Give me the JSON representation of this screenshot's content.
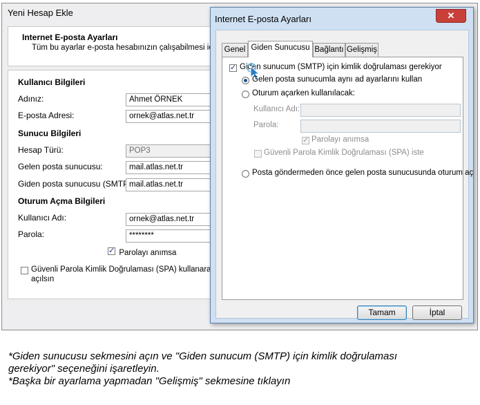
{
  "background_window": {
    "title": "Yeni Hesap Ekle",
    "header_title": "Internet E-posta Ayarları",
    "header_subtitle": "Tüm bu ayarlar e-posta hesabınızın çalışabilmesi için g",
    "user_section": "Kullanıcı Bilgileri",
    "name_label": "Adınız:",
    "name_value": "Ahmet ÖRNEK",
    "email_label": "E-posta Adresi:",
    "email_value": "ornek@atlas.net.tr",
    "server_section": "Sunucu Bilgileri",
    "account_type_label": "Hesap Türü:",
    "account_type_value": "POP3",
    "incoming_label": "Gelen posta sunucusu:",
    "incoming_value": "mail.atlas.net.tr",
    "outgoing_label": "Giden posta sunucusu (SMTP):",
    "outgoing_value": "mail.atlas.net.tr",
    "logon_section": "Oturum Açma Bilgileri",
    "username_label": "Kullanıcı Adı:",
    "username_value": "ornek@atlas.net.tr",
    "password_label": "Parola:",
    "password_value": "********",
    "remember_label": "Parolayı anımsa",
    "spa_label_line1": "Güvenli Parola Kimlik Doğrulaması (SPA) kullanarak otur",
    "spa_label_line2": "açılsın"
  },
  "dialog": {
    "title": "Internet E-posta Ayarları",
    "close_symbol": "✕",
    "tabs": [
      "Genel",
      "Giden Sunucusu",
      "Bağlantı",
      "Gelişmiş"
    ],
    "active_tab": "Giden Sunucusu",
    "smtp_auth_label": "Giden sunucum (SMTP) için kimlik doğrulaması gerekiyor",
    "same_settings_label": "Gelen posta sunucumla aynı ad ayarlarını kullan",
    "logon_using_label": "Oturum açarken kullanılacak:",
    "username_label": "Kullanıcı Adı:",
    "password_label": "Parola:",
    "remember_label": "Parolayı anımsa",
    "spa_label": "Güvenli Parola Kimlik Doğrulaması (SPA) iste",
    "logon_incoming_label": "Posta göndermeden önce gelen posta sunucusunda oturum aç",
    "ok_label": "Tamam",
    "cancel_label": "İptal"
  },
  "instructions": {
    "line1": "*Giden sunucusu sekmesini açın ve \"Giden sunucum (SMTP) için kimlik doğrulaması",
    "line2": "gerekiyor\" seçeneğini işaretleyin.",
    "line3": "*Başka bir ayarlama yapmadan \"Gelişmiş\" sekmesine tıklayın"
  },
  "colors": {
    "dialog_frame": "#cfe0f3",
    "close_button": "#c9403a",
    "radio_dot": "#1e4e8c"
  }
}
